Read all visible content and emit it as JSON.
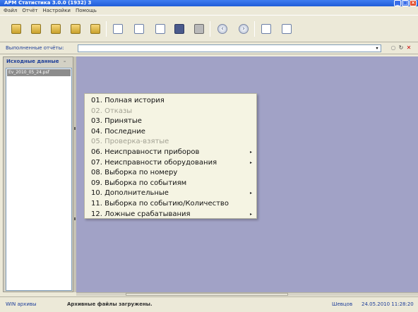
{
  "window": {
    "title": "АРМ Статистика 3.0.0 (1932) 3",
    "min_symbol": "_",
    "max_symbol": "□",
    "close_symbol": "×"
  },
  "menu_bar": {
    "items": [
      "Файл",
      "Отчёт",
      "Настройки",
      "Помощь"
    ]
  },
  "toolbar": {
    "icons": [
      "folder-icon",
      "folder-icon",
      "folder-icon",
      "folder-icon",
      "folder-up-icon",
      "document-icon",
      "document-icon",
      "document-icon",
      "save-icon",
      "print-icon",
      "back-icon",
      "forward-icon",
      "document-icon",
      "document-icon"
    ],
    "back_glyph": "‹",
    "forward_glyph": "›"
  },
  "reports": {
    "label": "Выполненные отчёты:",
    "value": "",
    "arrow": "▾",
    "pin_glyph": "○",
    "refresh_glyph": "↻",
    "close_glyph": "✕",
    "close_color": "#cc0000"
  },
  "source_panel": {
    "title": "Исходные данные",
    "collapse_glyph": "–",
    "items": [
      "Ev_2010_05_24.psf"
    ]
  },
  "context_menu": {
    "items": [
      {
        "label": "01. Полная история",
        "enabled": true,
        "submenu": false
      },
      {
        "label": "02. Отказы",
        "enabled": false,
        "submenu": false
      },
      {
        "label": "03. Принятые",
        "enabled": true,
        "submenu": false
      },
      {
        "label": "04. Последние",
        "enabled": true,
        "submenu": false
      },
      {
        "label": "05. Проверка-взятые",
        "enabled": false,
        "submenu": false
      },
      {
        "label": "06. Неисправности приборов",
        "enabled": true,
        "submenu": true
      },
      {
        "label": "07. Неисправности оборудования",
        "enabled": true,
        "submenu": true
      },
      {
        "label": "08. Выборка по номеру",
        "enabled": true,
        "submenu": false
      },
      {
        "label": "09. Выборка по событиям",
        "enabled": true,
        "submenu": false
      },
      {
        "label": "10. Дополнительные",
        "enabled": true,
        "submenu": true
      },
      {
        "label": "11. Выборка по событию/Количество",
        "enabled": true,
        "submenu": false
      },
      {
        "label": "12. Ложные срабатывания",
        "enabled": true,
        "submenu": true
      }
    ],
    "submenu_glyph": "▸"
  },
  "status_bar": {
    "app_mode": "WIN архивы",
    "message": "Архивные файлы загружены.",
    "user": "Шевцов",
    "datetime": "24.05.2010 11:28:20"
  },
  "colors": {
    "main_background": "#a1a2c6",
    "menu_background": "#f5f4e3",
    "label_blue": "#1c3d99"
  }
}
